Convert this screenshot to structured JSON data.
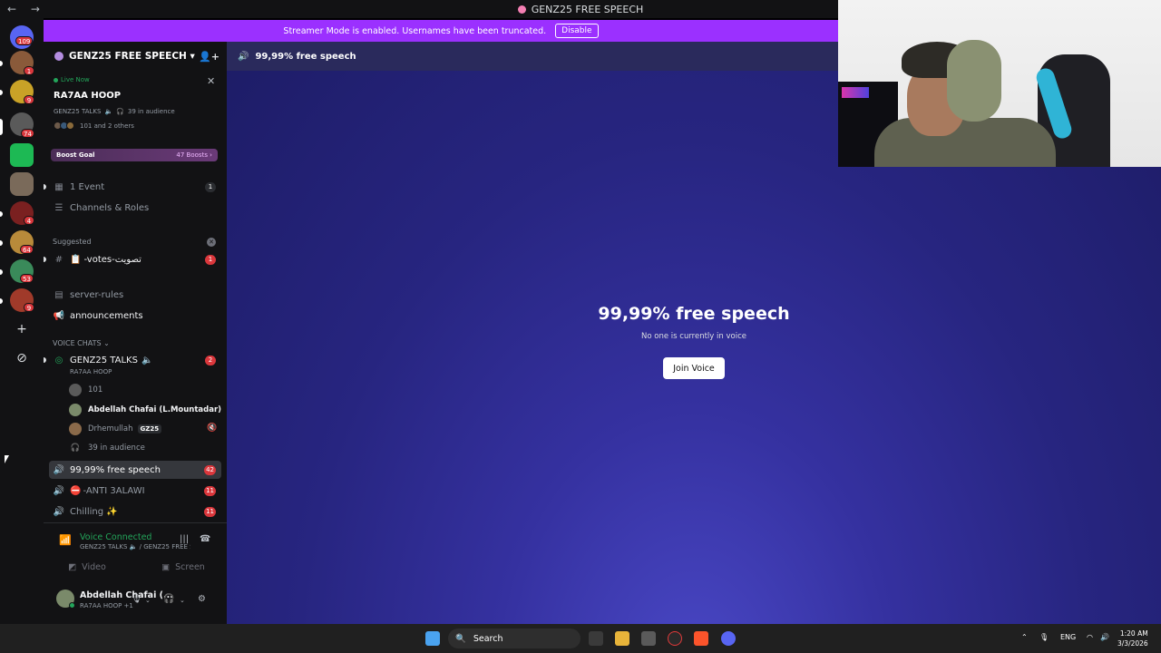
{
  "window": {
    "title": "GENZ25 FREE SPEECH",
    "nav_arrows": "← →"
  },
  "rail": {
    "servers": [
      {
        "name": "discord-home",
        "badge": "109",
        "color": "#5865f2"
      },
      {
        "name": "server-1",
        "badge": "1",
        "color": "#8a5a3a"
      },
      {
        "name": "server-2",
        "badge": "9",
        "color": "#c9a227"
      },
      {
        "name": "server-3",
        "badge": "74",
        "color": "#5a5a5a"
      },
      {
        "name": "server-4",
        "badge": "",
        "color": "#1db954"
      },
      {
        "name": "server-5",
        "badge": "",
        "color": "#7a6a5a"
      },
      {
        "name": "server-6",
        "badge": "4",
        "color": "#7a2020"
      },
      {
        "name": "server-7",
        "badge": "64",
        "color": "#b88a3a"
      },
      {
        "name": "server-8",
        "badge": "53",
        "color": "#3a8a5a"
      },
      {
        "name": "server-9",
        "badge": "9",
        "color": "#a03a2a"
      }
    ],
    "add_icon": "+",
    "discover_icon": "⊘"
  },
  "banner": {
    "text": "Streamer Mode is enabled. Usernames have been truncated.",
    "button": "Disable"
  },
  "server": {
    "name": "GENZ25 FREE SPEECH ▾"
  },
  "live": {
    "status": "Live Now",
    "host": "RA7AA HOOP",
    "channel": "GENZ25 TALKS",
    "audience": "39 in audience",
    "others": "101 and 2 others"
  },
  "boost": {
    "label": "Boost Goal",
    "count": "47 Boosts ›"
  },
  "channels": {
    "event": {
      "label": "1 Event",
      "count": "1"
    },
    "roles": {
      "label": "Channels & Roles"
    },
    "suggested_header": "Suggested",
    "votes": {
      "label": "-votes-تصويت",
      "count": "1"
    },
    "server_rules": {
      "label": "server-rules"
    },
    "announcements": {
      "label": "announcements"
    },
    "voice_header": "VOICE CHATS ⌄",
    "genz_talks": {
      "label": "GENZ25 TALKS",
      "sub": "RA7AA HOOP",
      "count": "2"
    },
    "voice_users": [
      {
        "name": "101"
      },
      {
        "name": "Abdellah Chafai (L.Mountadar)"
      },
      {
        "name": "Drhemullah",
        "tag": "GZ25"
      }
    ],
    "audience_row": "39 in audience",
    "free_speech": {
      "label": "99,99% free speech",
      "count": "42"
    },
    "anti": {
      "label": "-ANTI 3ALAWI",
      "count": "11"
    },
    "chilling": {
      "label": "Chilling ✨",
      "count": "11"
    }
  },
  "voice_connected": {
    "status": "Voice Connected",
    "sub": "GENZ25 TALKS 🔈 / GENZ25 FREE SPE...",
    "video": "Video",
    "screen": "Screen"
  },
  "user": {
    "name": "Abdellah Chafai (...",
    "status": "RA7AA HOOP +1"
  },
  "main": {
    "header": "99,99% free speech",
    "title": "99,99% free speech",
    "subtitle": "No one is currently in voice",
    "join": "Join Voice"
  },
  "taskbar": {
    "search": "Search",
    "lang": "ENG",
    "time": "1:20 AM",
    "date": "3/3/2026"
  }
}
